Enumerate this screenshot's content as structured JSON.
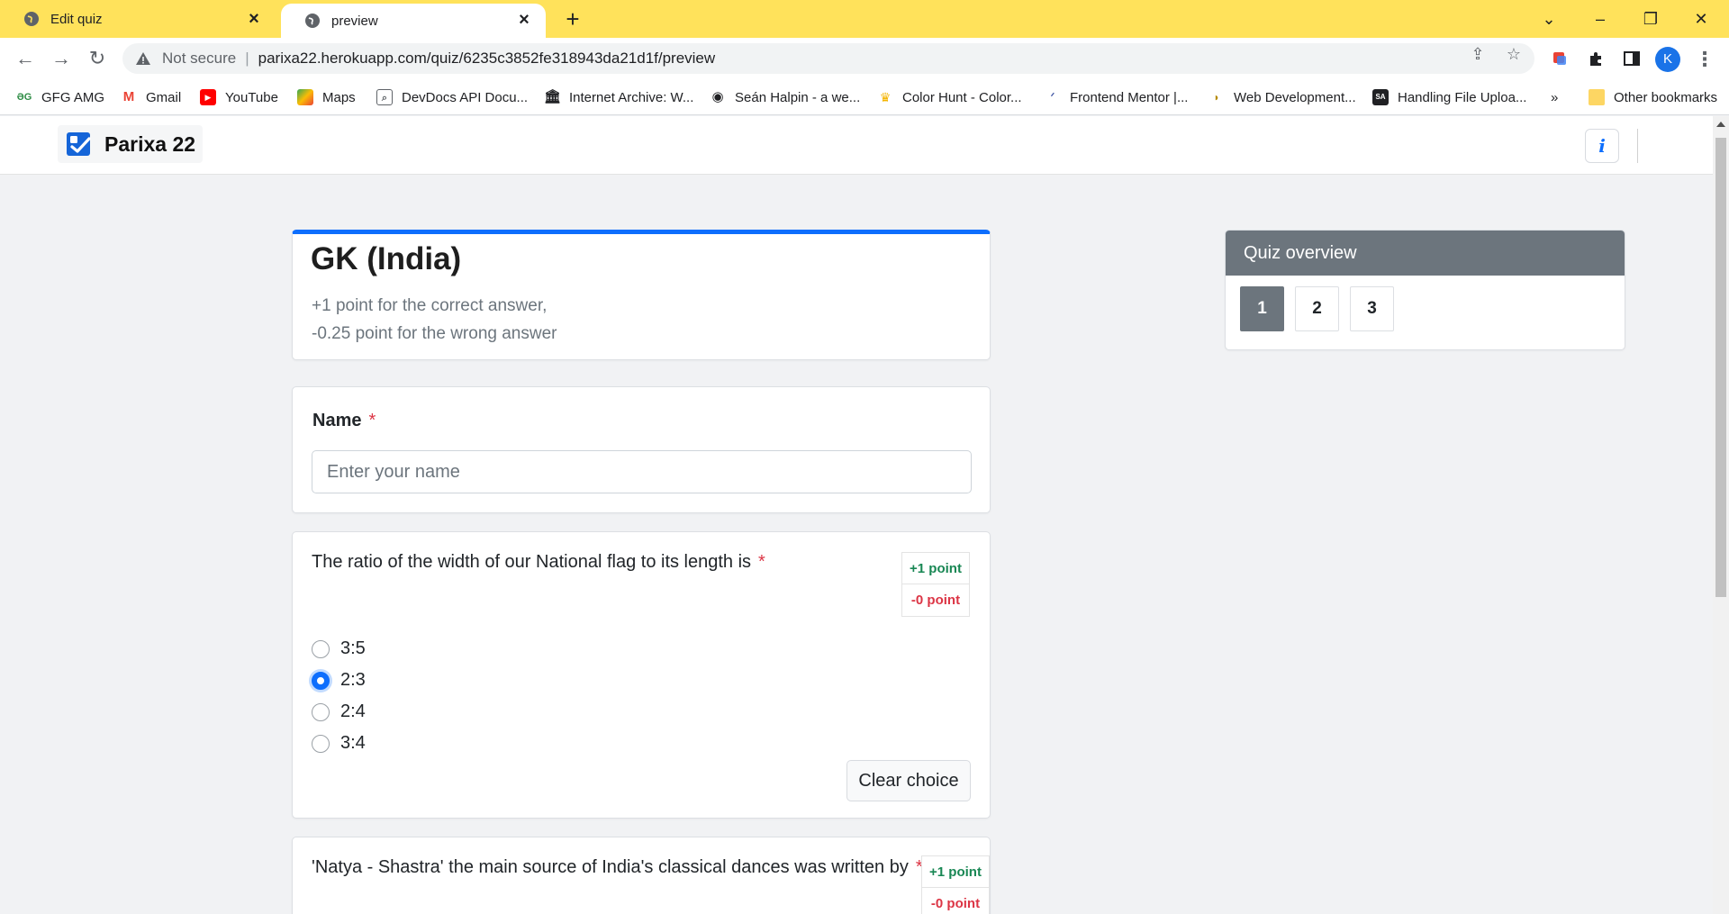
{
  "browser": {
    "tabs": [
      {
        "title": "Edit quiz",
        "active": false
      },
      {
        "title": "preview",
        "active": true
      }
    ],
    "address": {
      "security": "Not secure",
      "url": "parixa22.herokuapp.com/quiz/6235c3852fe318943da21d1f/preview"
    },
    "profile_initial": "K",
    "bookmarks": [
      {
        "label": "GFG AMG",
        "icon": "gfg-icon"
      },
      {
        "label": "Gmail",
        "icon": "gmail-icon"
      },
      {
        "label": "YouTube",
        "icon": "youtube-icon"
      },
      {
        "label": "Maps",
        "icon": "maps-icon"
      },
      {
        "label": "DevDocs API Docu...",
        "icon": "devdocs-icon"
      },
      {
        "label": "Internet Archive: W...",
        "icon": "archive-icon"
      },
      {
        "label": "Seán Halpin - a we...",
        "icon": "eye-icon"
      },
      {
        "label": "Color Hunt - Color...",
        "icon": "colorhunt-icon"
      },
      {
        "label": "Frontend Mentor |...",
        "icon": "frontendmentor-icon"
      },
      {
        "label": "Web Development...",
        "icon": "webdev-icon"
      },
      {
        "label": "Handling File Uploa...",
        "icon": "sa-icon"
      }
    ],
    "other_bookmarks": "Other bookmarks",
    "overflow": "»"
  },
  "app": {
    "brand": "Parixa 22",
    "info_label": "i"
  },
  "quiz": {
    "title": "GK (India)",
    "desc_line1": "+1 point for the correct answer,",
    "desc_line2": "-0.25 point for the wrong answer"
  },
  "name_field": {
    "label": "Name",
    "required_mark": "*",
    "placeholder": "Enter your name"
  },
  "questions": [
    {
      "text": "The ratio of the width of our National flag to its length is",
      "required_mark": "*",
      "plus_points": "+1 point",
      "minus_points": "-0 point",
      "options": [
        "3:5",
        "2:3",
        "2:4",
        "3:4"
      ],
      "selected": "2:3",
      "clear_label": "Clear choice"
    },
    {
      "text": "'Natya - Shastra' the main source of India's classical dances was written by",
      "required_mark": "*",
      "plus_points": "+1 point",
      "minus_points": "-0 point"
    }
  ],
  "overview": {
    "title": "Quiz overview",
    "numbers": [
      "1",
      "2",
      "3"
    ],
    "active": "1"
  },
  "colors": {
    "tabstrip": "#ffe25b",
    "accent": "#0d6efd",
    "plus": "#198754",
    "minus": "#dc3545",
    "overview_header": "#6c757d"
  }
}
